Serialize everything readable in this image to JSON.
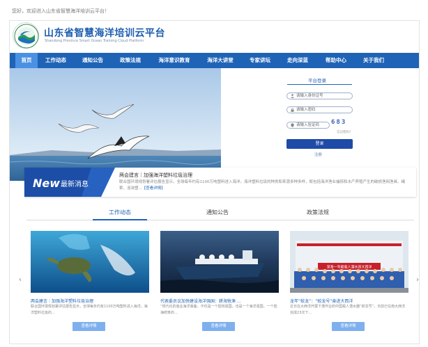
{
  "topbar": {
    "welcome": "您好，欢迎进入山东省智慧海洋培训云平台！"
  },
  "header": {
    "title_cn": "山东省智慧海洋培训云平台",
    "title_en": "Shandong Province Smart Ocean Training Cloud Platform"
  },
  "nav": {
    "items": [
      "首页",
      "工作动态",
      "通知公告",
      "政策法规",
      "海洋意识教育",
      "海洋大讲堂",
      "专家讲坛",
      "走向深蓝",
      "帮助中心",
      "关于我们"
    ],
    "active_index": 0
  },
  "login": {
    "title": "平台登录",
    "id_placeholder": "请输入身份证号",
    "password_placeholder": "请输入密码",
    "captcha_placeholder": "请输入验证码",
    "captcha_code": "683",
    "forgot": "忘记密码?",
    "login_button": "登录",
    "register": "注册"
  },
  "news_banner": {
    "badge_new": "New",
    "badge_label": "最新消息",
    "title": "两会建言｜加强海洋塑料垃圾治理",
    "desc": "联合国环境规划署评估报告显示，全球每年约有1100万吨塑料进入海洋。海洋塑料垃圾的种类和来源多种多样，既包括海洋渔业捕捞和水产养殖产生的破损渔网渔具、绳索、泡沫塑...",
    "more": "【查看详情】"
  },
  "tabs": {
    "items": [
      "工作动态",
      "通知公告",
      "政策法规"
    ],
    "active_index": 0
  },
  "cards": [
    {
      "title": "两会建言｜加强海洋塑料垃圾治理",
      "desc": "联合国环境规划署评估报告显示，全球每年约有1100万吨塑料进入海洋。海洋塑料垃圾的...",
      "button": "查看详情"
    },
    {
      "title": "代表委员议加快建设海洋强国：耕海牧渔 ...",
      "desc": "“现代化的渔业海洋装备，不仅是一个陆地强国，也是一个海洋强国，一个陆海统筹的...",
      "button": "查看详情"
    },
    {
      "title": "龙年“蛟龙”：“蛟龙号”奋进大西洋",
      "desc": "近日在大西洋开展下潜作业的中国载人潜水器“蛟龙号”，日前已在南大西洋完成23次下...",
      "button": "查看详情"
    }
  ],
  "card3_banner": "深海一号船载人潜水员大西洋",
  "colors": {
    "primary": "#1e63b6",
    "nav_active": "#4b91e3",
    "button": "#1e4aa8",
    "card_button": "#7eb0ee"
  }
}
